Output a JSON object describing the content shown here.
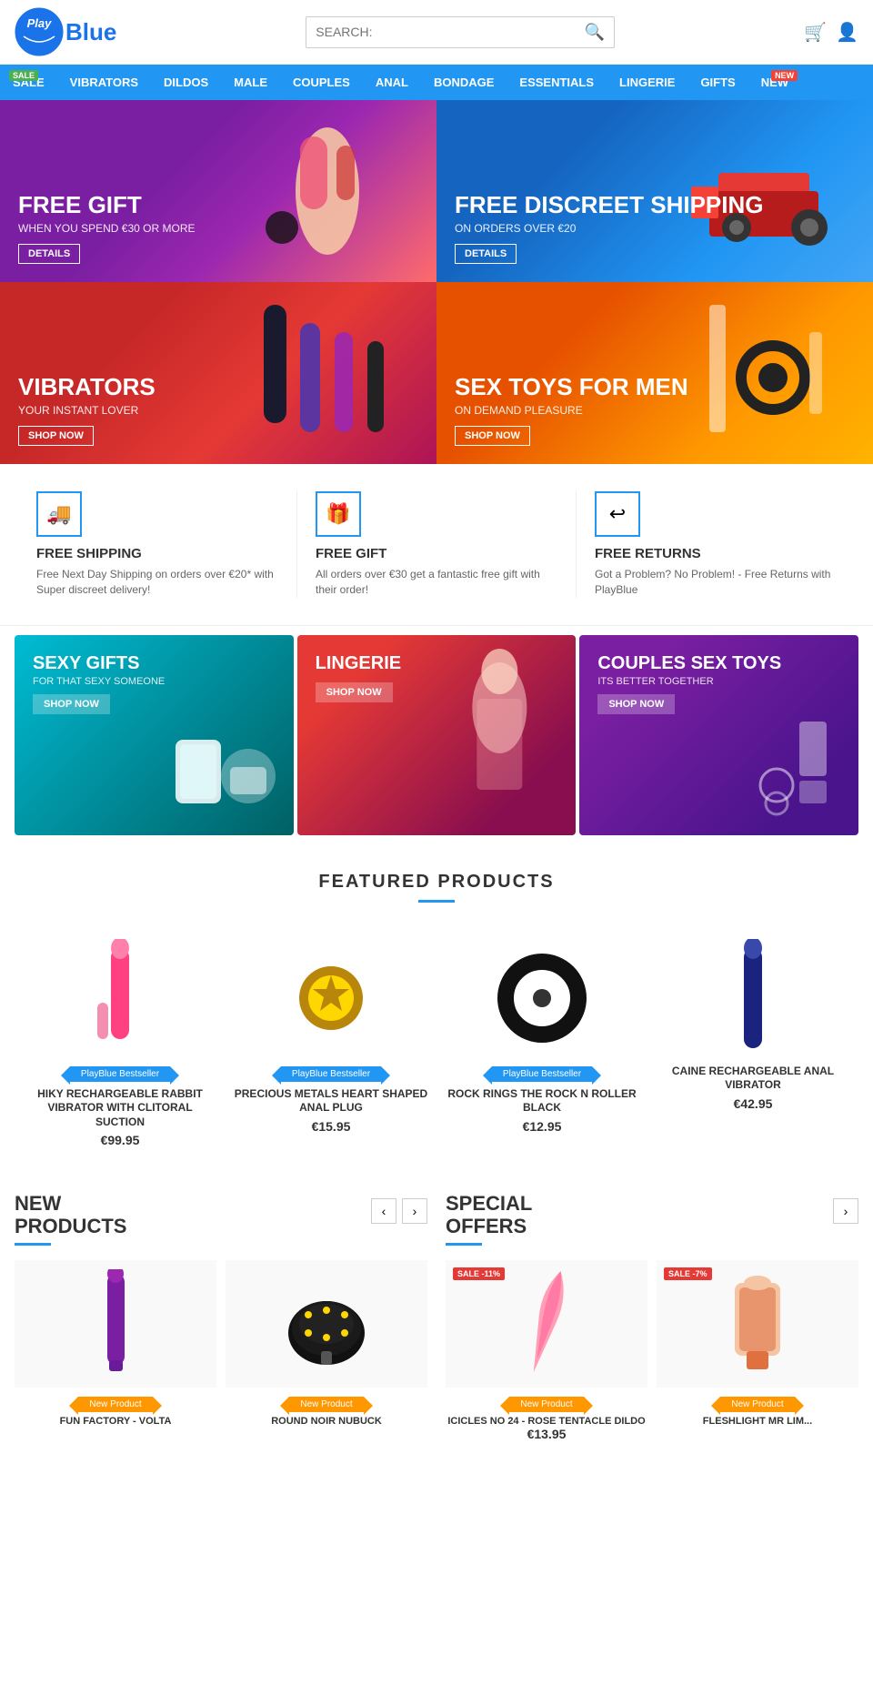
{
  "header": {
    "logo_play": "Play",
    "logo_blue": "Blue",
    "search_placeholder": "SEARCH:",
    "cart_icon": "🛒",
    "user_icon": "👤"
  },
  "nav": {
    "items": [
      {
        "label": "SALE",
        "href": "#",
        "badge": "SALE",
        "badge_type": "sale"
      },
      {
        "label": "VIBRATORS",
        "href": "#"
      },
      {
        "label": "DILDOS",
        "href": "#"
      },
      {
        "label": "MALE",
        "href": "#"
      },
      {
        "label": "COUPLES",
        "href": "#"
      },
      {
        "label": "ANAL",
        "href": "#"
      },
      {
        "label": "BONDAGE",
        "href": "#"
      },
      {
        "label": "ESSENTIALS",
        "href": "#"
      },
      {
        "label": "LINGERIE",
        "href": "#"
      },
      {
        "label": "GIFTS",
        "href": "#"
      },
      {
        "label": "NEW",
        "href": "#",
        "badge": "NEW",
        "badge_type": "new"
      }
    ]
  },
  "hero": {
    "banner1": {
      "title": "FREE GIFT",
      "subtitle": "WHEN YOU SPEND €30 OR MORE",
      "btn": "DETAILS"
    },
    "banner2": {
      "title": "FREE DISCREET SHIPPING",
      "subtitle": "ON ORDERS OVER €20",
      "btn": "DETAILS"
    },
    "banner3": {
      "title": "VIBRATORS",
      "subtitle": "YOUR INSTANT LOVER",
      "btn": "SHOP NOW"
    },
    "banner4": {
      "title": "SEX TOYS FOR MEN",
      "subtitle": "ON DEMAND PLEASURE",
      "btn": "SHOP NOW"
    }
  },
  "features": [
    {
      "icon": "🚚",
      "title": "FREE SHIPPING",
      "desc": "Free Next Day Shipping on orders over €20* with Super discreet delivery!"
    },
    {
      "icon": "🎁",
      "title": "FREE GIFT",
      "desc": "All orders over €30 get a fantastic free gift with their order!"
    },
    {
      "icon": "↩",
      "title": "FREE RETURNS",
      "desc": "Got a Problem? No Problem! - Free Returns with PlayBlue"
    }
  ],
  "promos": [
    {
      "title": "SEXY GIFTS",
      "sub": "FOR THAT SEXY SOMEONE",
      "btn": "SHOP NOW",
      "bg": "promo-1"
    },
    {
      "title": "LINGERIE",
      "sub": "",
      "btn": "SHOP NOW",
      "bg": "promo-2"
    },
    {
      "title": "COUPLES SEX TOYS",
      "sub": "ITS BETTER TOGETHER",
      "btn": "SHOP NOW",
      "bg": "promo-3"
    }
  ],
  "featured": {
    "section_title": "FEATURED PRODUCTS",
    "products": [
      {
        "badge": "PlayBlue Bestseller",
        "name": "HIKY RECHARGEABLE RABBIT VIBRATOR WITH CLITORAL SUCTION",
        "price": "€99.95",
        "shape": "vibrator"
      },
      {
        "badge": "PlayBlue Bestseller",
        "name": "PRECIOUS METALS HEART SHAPED ANAL PLUG",
        "price": "€15.95",
        "shape": "plug"
      },
      {
        "badge": "PlayBlue Bestseller",
        "name": "ROCK RINGS THE ROCK N ROLLER BLACK",
        "price": "€12.95",
        "shape": "ring"
      },
      {
        "badge": "",
        "name": "CAINE RECHARGEABLE ANAL VIBRATOR",
        "price": "€42.95",
        "shape": "anal"
      }
    ]
  },
  "new_products": {
    "title": "NEW\nPRODUCTS",
    "products": [
      {
        "name": "FUN FACTORY - VOLTA",
        "badge": "New Product",
        "shape": "bottle"
      },
      {
        "name": "ROUND NOIR NUBUCK",
        "badge": "New Product",
        "shape": "paddle"
      }
    ]
  },
  "special_offers": {
    "title": "SPECIAL\nOFFERS",
    "products": [
      {
        "name": "ICICLES NO 24 - ROSE TENTACLE DILDO",
        "badge": "New Product",
        "sale_tag": "SALE -11%",
        "price": "€13.95",
        "shape": "dildo"
      },
      {
        "name": "FLESHLIGHT MR LIM...",
        "badge": "New Product",
        "sale_tag": "SALE -7%",
        "price": "",
        "shape": "flesh"
      }
    ]
  }
}
